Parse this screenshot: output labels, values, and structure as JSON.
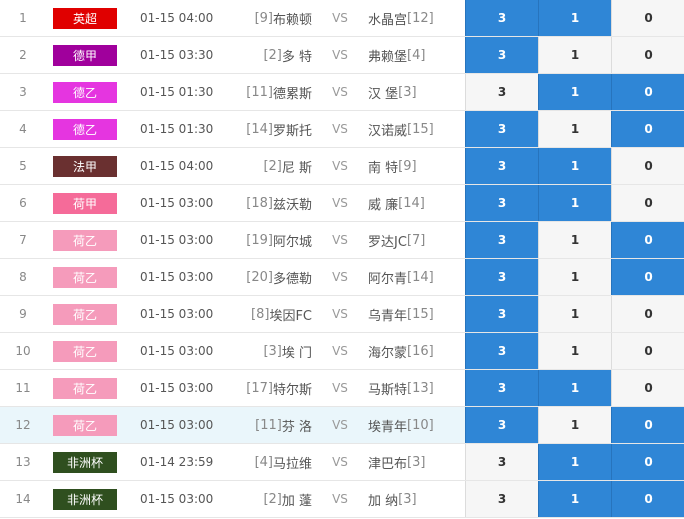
{
  "colors": {
    "odds_highlight": "#2f86d6",
    "row_highlight": "#eaf6fb"
  },
  "vs_label": "VS",
  "matches": [
    {
      "idx": "1",
      "league": "英超",
      "league_color": "#e00000",
      "time": "01-15 04:00",
      "home_rank": "[9]",
      "home": "布赖顿",
      "away": "水晶宫",
      "away_rank": "[12]",
      "s1": "3",
      "s2": "1",
      "s3": "0",
      "hot": [
        true,
        true,
        false
      ],
      "highlight": false
    },
    {
      "idx": "2",
      "league": "德甲",
      "league_color": "#a0009c",
      "time": "01-15 03:30",
      "home_rank": "[2]",
      "home": "多 特",
      "away": "弗赖堡",
      "away_rank": "[4]",
      "s1": "3",
      "s2": "1",
      "s3": "0",
      "hot": [
        true,
        false,
        false
      ],
      "highlight": false
    },
    {
      "idx": "3",
      "league": "德乙",
      "league_color": "#e535e0",
      "time": "01-15 01:30",
      "home_rank": "[11]",
      "home": "德累斯",
      "away": "汉 堡",
      "away_rank": "[3]",
      "s1": "3",
      "s2": "1",
      "s3": "0",
      "hot": [
        false,
        true,
        true
      ],
      "highlight": false
    },
    {
      "idx": "4",
      "league": "德乙",
      "league_color": "#e535e0",
      "time": "01-15 01:30",
      "home_rank": "[14]",
      "home": "罗斯托",
      "away": "汉诺威",
      "away_rank": "[15]",
      "s1": "3",
      "s2": "1",
      "s3": "0",
      "hot": [
        true,
        false,
        true
      ],
      "highlight": false
    },
    {
      "idx": "5",
      "league": "法甲",
      "league_color": "#6a3030",
      "time": "01-15 04:00",
      "home_rank": "[2]",
      "home": "尼 斯",
      "away": "南 特",
      "away_rank": "[9]",
      "s1": "3",
      "s2": "1",
      "s3": "0",
      "hot": [
        true,
        true,
        false
      ],
      "highlight": false
    },
    {
      "idx": "6",
      "league": "荷甲",
      "league_color": "#f56b99",
      "time": "01-15 03:00",
      "home_rank": "[18]",
      "home": "兹沃勒",
      "away": "威 廉",
      "away_rank": "[14]",
      "s1": "3",
      "s2": "1",
      "s3": "0",
      "hot": [
        true,
        true,
        false
      ],
      "highlight": false
    },
    {
      "idx": "7",
      "league": "荷乙",
      "league_color": "#f59bbb",
      "time": "01-15 03:00",
      "home_rank": "[19]",
      "home": "阿尔城",
      "away": "罗达JC",
      "away_rank": "[7]",
      "s1": "3",
      "s2": "1",
      "s3": "0",
      "hot": [
        true,
        false,
        true
      ],
      "highlight": false
    },
    {
      "idx": "8",
      "league": "荷乙",
      "league_color": "#f59bbb",
      "time": "01-15 03:00",
      "home_rank": "[20]",
      "home": "多德勒",
      "away": "阿尔青",
      "away_rank": "[14]",
      "s1": "3",
      "s2": "1",
      "s3": "0",
      "hot": [
        true,
        false,
        true
      ],
      "highlight": false
    },
    {
      "idx": "9",
      "league": "荷乙",
      "league_color": "#f59bbb",
      "time": "01-15 03:00",
      "home_rank": "[8]",
      "home": "埃因FC",
      "away": "乌青年",
      "away_rank": "[15]",
      "s1": "3",
      "s2": "1",
      "s3": "0",
      "hot": [
        true,
        false,
        false
      ],
      "highlight": false
    },
    {
      "idx": "10",
      "league": "荷乙",
      "league_color": "#f59bbb",
      "time": "01-15 03:00",
      "home_rank": "[3]",
      "home": "埃 门",
      "away": "海尔蒙",
      "away_rank": "[16]",
      "s1": "3",
      "s2": "1",
      "s3": "0",
      "hot": [
        true,
        false,
        false
      ],
      "highlight": false
    },
    {
      "idx": "11",
      "league": "荷乙",
      "league_color": "#f59bbb",
      "time": "01-15 03:00",
      "home_rank": "[17]",
      "home": "特尔斯",
      "away": "马斯特",
      "away_rank": "[13]",
      "s1": "3",
      "s2": "1",
      "s3": "0",
      "hot": [
        true,
        true,
        false
      ],
      "highlight": false
    },
    {
      "idx": "12",
      "league": "荷乙",
      "league_color": "#f59bbb",
      "time": "01-15 03:00",
      "home_rank": "[11]",
      "home": "芬 洛",
      "away": "埃青年",
      "away_rank": "[10]",
      "s1": "3",
      "s2": "1",
      "s3": "0",
      "hot": [
        true,
        false,
        true
      ],
      "highlight": true
    },
    {
      "idx": "13",
      "league": "非洲杯",
      "league_color": "#2f4f1f",
      "time": "01-14 23:59",
      "home_rank": "[4]",
      "home": "马拉维",
      "away": "津巴布",
      "away_rank": "[3]",
      "s1": "3",
      "s2": "1",
      "s3": "0",
      "hot": [
        false,
        true,
        true
      ],
      "highlight": false
    },
    {
      "idx": "14",
      "league": "非洲杯",
      "league_color": "#2f4f1f",
      "time": "01-15 03:00",
      "home_rank": "[2]",
      "home": "加 蓬",
      "away": "加 纳",
      "away_rank": "[3]",
      "s1": "3",
      "s2": "1",
      "s3": "0",
      "hot": [
        false,
        true,
        true
      ],
      "highlight": false
    }
  ]
}
